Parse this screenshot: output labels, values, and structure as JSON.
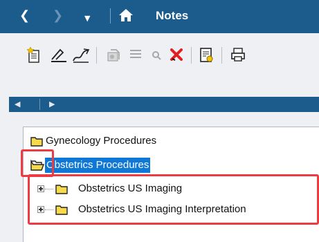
{
  "window": {
    "title": "Notes",
    "nav": {
      "back": "❮",
      "forward": "❯",
      "menu": "▼"
    }
  },
  "toolbar": {
    "icons": [
      "new-note-icon",
      "sign-icon",
      "forward-sign-icon",
      "attach-icon",
      "list-icon",
      "search-icon",
      "delete-icon",
      "document-icon",
      "print-icon"
    ]
  },
  "tab_scroller": {
    "left": "◀",
    "right": "▶"
  },
  "tree": {
    "items": [
      {
        "label": "Gynecology Procedures",
        "level": 0,
        "state": "closed"
      },
      {
        "label": "Obstetrics Procedures",
        "level": 0,
        "state": "open",
        "selected": true
      },
      {
        "label": "Obstetrics US Imaging",
        "level": 1,
        "expandable": true
      },
      {
        "label": "Obstetrics US Imaging Interpretation",
        "level": 1,
        "expandable": true
      }
    ]
  },
  "colors": {
    "title_bar": "#1c5c8c",
    "selection": "#0f78d7",
    "highlight": "#ee3a43",
    "folder": "#f7d94c"
  }
}
